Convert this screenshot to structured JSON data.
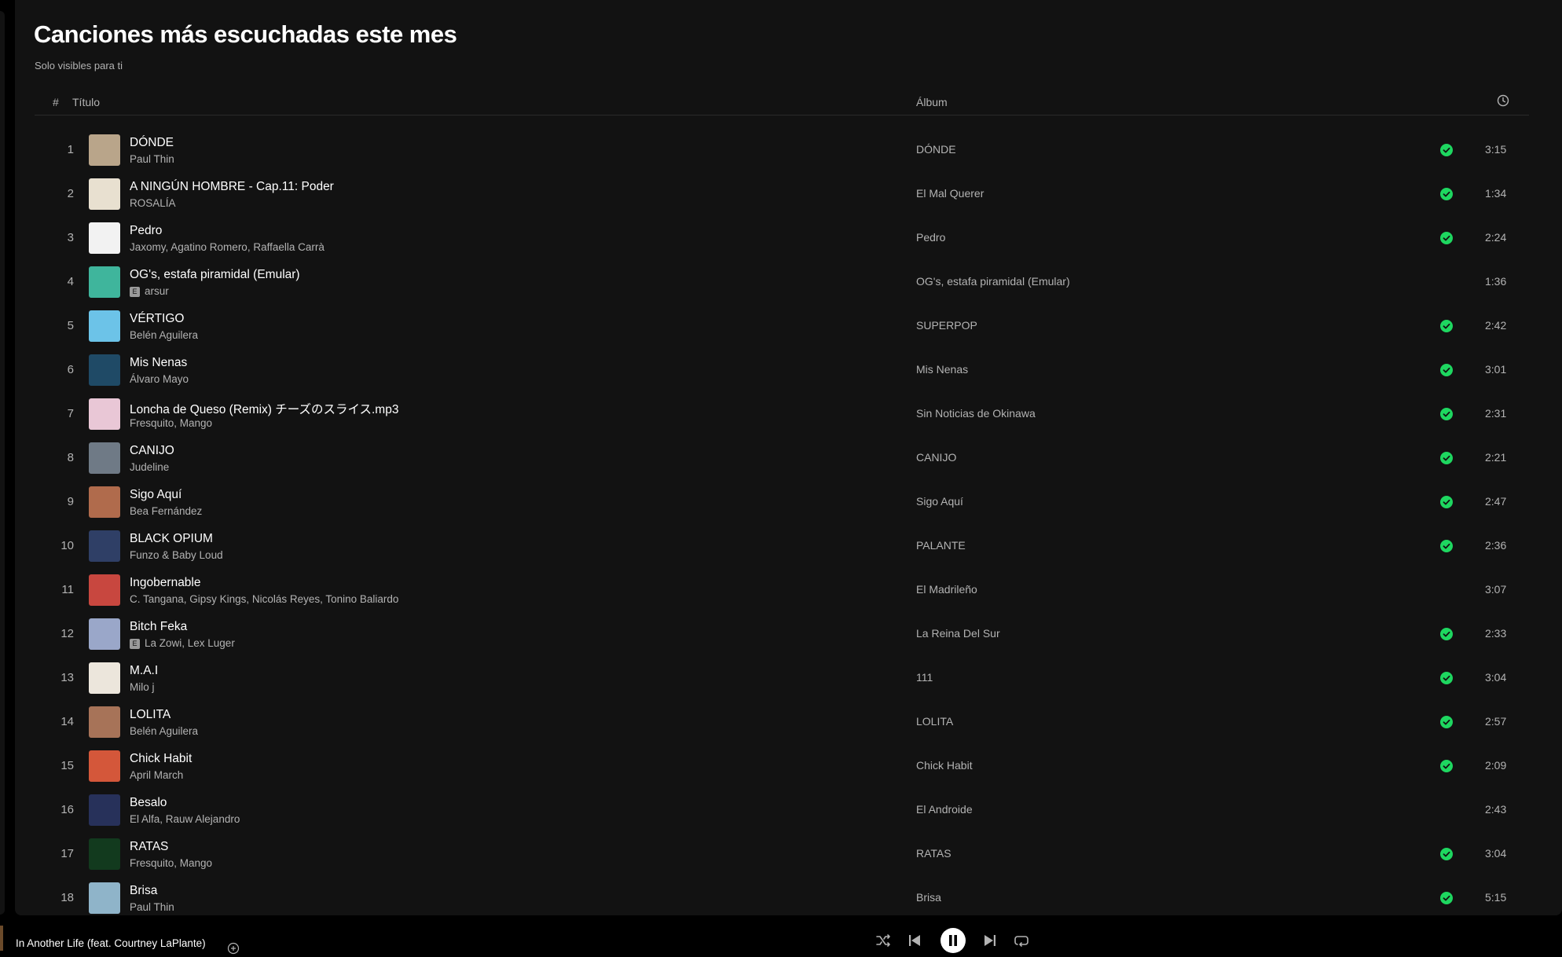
{
  "page": {
    "heading": "Canciones más escuchadas este mes",
    "subheading": "Solo visibles para ti"
  },
  "table": {
    "headers": {
      "num": "#",
      "title": "Título",
      "album": "Álbum",
      "duration_icon": "clock-icon"
    },
    "rows": [
      {
        "num": "1",
        "title": "DÓNDE",
        "artist": "Paul Thin",
        "explicit": false,
        "album": "DÓNDE",
        "saved": true,
        "duration": "3:15",
        "cover_color": "#b9a58a"
      },
      {
        "num": "2",
        "title": "A NINGÚN HOMBRE - Cap.11: Poder",
        "artist": "ROSALÍA",
        "explicit": false,
        "album": "El Mal Querer",
        "saved": true,
        "duration": "1:34",
        "cover_color": "#e8e0d0"
      },
      {
        "num": "3",
        "title": "Pedro",
        "artist": "Jaxomy, Agatino Romero, Raffaella Carrà",
        "explicit": false,
        "album": "Pedro",
        "saved": true,
        "duration": "2:24",
        "cover_color": "#f2f2f2"
      },
      {
        "num": "4",
        "title": "OG's, estafa piramidal (Emular)",
        "artist": "arsur",
        "explicit": true,
        "album": "OG's, estafa piramidal (Emular)",
        "saved": false,
        "duration": "1:36",
        "cover_color": "#3fb59c"
      },
      {
        "num": "5",
        "title": "VÉRTIGO",
        "artist": "Belén Aguilera",
        "explicit": false,
        "album": "SUPERPOP",
        "saved": true,
        "duration": "2:42",
        "cover_color": "#6cc3e8"
      },
      {
        "num": "6",
        "title": "Mis Nenas",
        "artist": "Álvaro Mayo",
        "explicit": false,
        "album": "Mis Nenas",
        "saved": true,
        "duration": "3:01",
        "cover_color": "#1f4a66"
      },
      {
        "num": "7",
        "title": "Loncha de Queso (Remix) チーズのスライス.mp3",
        "artist": "Fresquito, Mango",
        "explicit": false,
        "album": "Sin Noticias de Okinawa",
        "saved": true,
        "duration": "2:31",
        "cover_color": "#e9c7d6"
      },
      {
        "num": "8",
        "title": "CANIJO",
        "artist": "Judeline",
        "explicit": false,
        "album": "CANIJO",
        "saved": true,
        "duration": "2:21",
        "cover_color": "#6f7a86"
      },
      {
        "num": "9",
        "title": "Sigo Aquí",
        "artist": "Bea Fernández",
        "explicit": false,
        "album": "Sigo Aquí",
        "saved": true,
        "duration": "2:47",
        "cover_color": "#b06b4c"
      },
      {
        "num": "10",
        "title": "BLACK OPIUM",
        "artist": "Funzo & Baby Loud",
        "explicit": false,
        "album": "PALANTE",
        "saved": true,
        "duration": "2:36",
        "cover_color": "#2f3f66"
      },
      {
        "num": "11",
        "title": "Ingobernable",
        "artist": "C. Tangana, Gipsy Kings, Nicolás Reyes, Tonino Baliardo",
        "explicit": false,
        "album": "El Madrileño",
        "saved": false,
        "duration": "3:07",
        "cover_color": "#c8473f"
      },
      {
        "num": "12",
        "title": "Bitch Feka",
        "artist": "La Zowi, Lex Luger",
        "explicit": true,
        "album": "La Reina Del Sur",
        "saved": true,
        "duration": "2:33",
        "cover_color": "#9aa7c9"
      },
      {
        "num": "13",
        "title": "M.A.I",
        "artist": "Milo j",
        "explicit": false,
        "album": "111",
        "saved": true,
        "duration": "3:04",
        "cover_color": "#ece6dc"
      },
      {
        "num": "14",
        "title": "LOLITA",
        "artist": "Belén Aguilera",
        "explicit": false,
        "album": "LOLITA",
        "saved": true,
        "duration": "2:57",
        "cover_color": "#a77358"
      },
      {
        "num": "15",
        "title": "Chick Habit",
        "artist": "April March",
        "explicit": false,
        "album": "Chick Habit",
        "saved": true,
        "duration": "2:09",
        "cover_color": "#d4573a"
      },
      {
        "num": "16",
        "title": "Besalo",
        "artist": "El Alfa, Rauw Alejandro",
        "explicit": false,
        "album": "El Androide",
        "saved": false,
        "duration": "2:43",
        "cover_color": "#27315a"
      },
      {
        "num": "17",
        "title": "RATAS",
        "artist": "Fresquito, Mango",
        "explicit": false,
        "album": "RATAS",
        "saved": true,
        "duration": "3:04",
        "cover_color": "#123a1e"
      },
      {
        "num": "18",
        "title": "Brisa",
        "artist": "Paul Thin",
        "explicit": false,
        "album": "Brisa",
        "saved": true,
        "duration": "5:15",
        "cover_color": "#8fb4c9"
      }
    ]
  },
  "player": {
    "now_playing_title": "In Another Life (feat. Courtney LaPlante)",
    "controls": [
      "shuffle-icon",
      "previous-icon",
      "pause-icon",
      "next-icon",
      "repeat-icon"
    ]
  },
  "colors": {
    "background": "#121212",
    "accent_green": "#1ed760",
    "text_secondary": "#b3b3b3"
  },
  "explicit_badge": "E"
}
